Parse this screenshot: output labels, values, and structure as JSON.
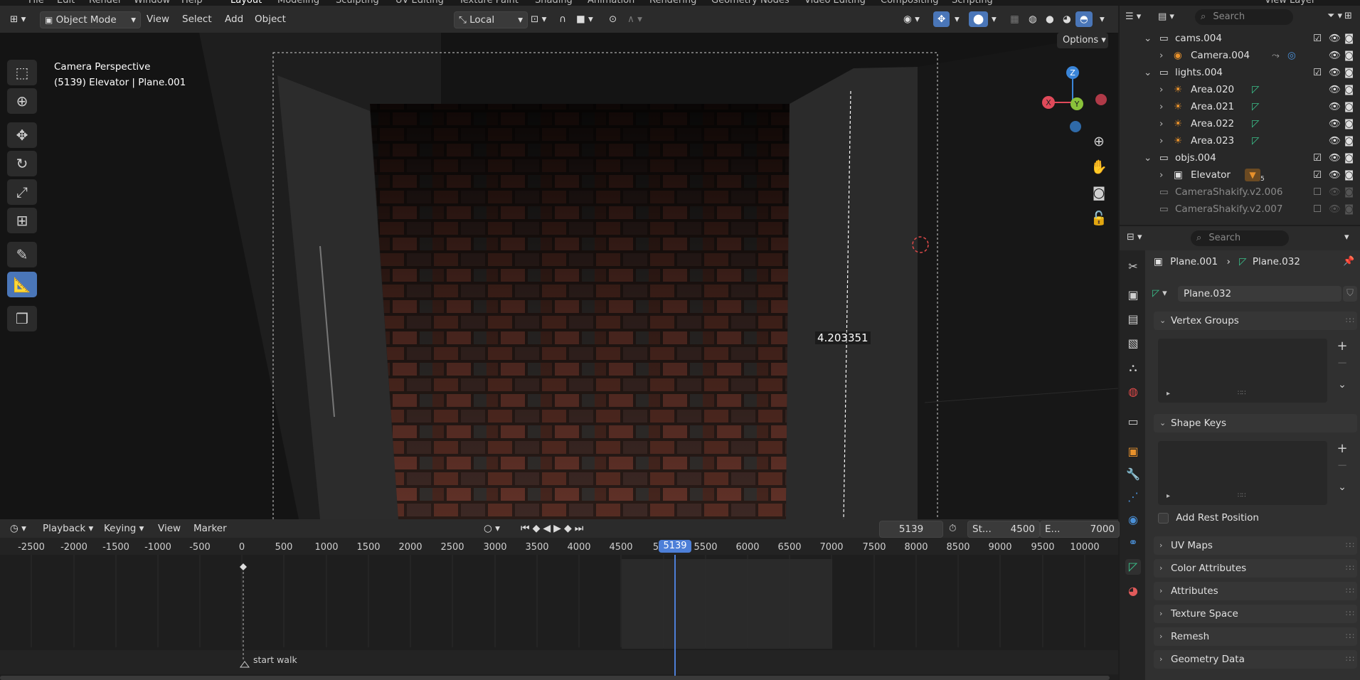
{
  "top_strip": {
    "items": [
      "File",
      "Edit",
      "Render",
      "Window",
      "Help",
      "Layout",
      "Modeling",
      "Sculpting",
      "UV Editing",
      "Texture Paint",
      "Shading",
      "Animation",
      "Rendering",
      "Geometry Nodes",
      "Video Editing",
      "Compositing",
      "Scripting",
      "View Layer"
    ]
  },
  "viewport_header": {
    "mode": "Object Mode",
    "menus": [
      "View",
      "Select",
      "Add",
      "Object"
    ],
    "orientation": "Local",
    "options_label": "Options"
  },
  "viewport": {
    "overlay_line1": "Camera Perspective",
    "overlay_line2": "(5139) Elevator | Plane.001",
    "measure_value": "4.203351",
    "gizmo": {
      "z": "Z",
      "y": "Y",
      "x": "X"
    },
    "tools": [
      "select-box-icon",
      "cursor-icon",
      "move-icon",
      "rotate-icon",
      "scale-icon",
      "transform-icon",
      "annotate-icon",
      "measure-icon",
      "add-cube-icon"
    ],
    "active_tool": "measure-icon"
  },
  "timeline": {
    "menus": [
      "Playback",
      "Keying",
      "View",
      "Marker"
    ],
    "current_frame": "5139",
    "start_label": "St...",
    "start_value": "4500",
    "end_label": "E...",
    "end_value": "7000",
    "ruler_ticks": [
      "-2500",
      "-2000",
      "-1500",
      "-1000",
      "-500",
      "0",
      "500",
      "1000",
      "1500",
      "2000",
      "2500",
      "3000",
      "3500",
      "4000",
      "4500",
      "5",
      "5500",
      "6000",
      "6500",
      "7000",
      "7500",
      "8000",
      "8500",
      "9000",
      "9500",
      "10000"
    ],
    "marker_label": "start walk",
    "playhead_label": "5139"
  },
  "outliner": {
    "search_placeholder": "Search",
    "rows": [
      {
        "label": "cams.004",
        "type": "collection",
        "level": 0,
        "expanded": true,
        "enabled": true
      },
      {
        "label": "Camera.004",
        "type": "camera",
        "level": 1,
        "expanded": false,
        "enabled": true
      },
      {
        "label": "lights.004",
        "type": "collection",
        "level": 0,
        "expanded": true,
        "enabled": true
      },
      {
        "label": "Area.020",
        "type": "light",
        "level": 1,
        "expanded": false,
        "enabled": true
      },
      {
        "label": "Area.021",
        "type": "light",
        "level": 1,
        "expanded": false,
        "enabled": true
      },
      {
        "label": "Area.022",
        "type": "light",
        "level": 1,
        "expanded": false,
        "enabled": true
      },
      {
        "label": "Area.023",
        "type": "light",
        "level": 1,
        "expanded": false,
        "enabled": true
      },
      {
        "label": "objs.004",
        "type": "collection",
        "level": 0,
        "expanded": true,
        "enabled": true
      },
      {
        "label": "Elevator",
        "type": "object",
        "level": 1,
        "expanded": false,
        "enabled": true,
        "badge": "5"
      },
      {
        "label": "CameraShakify.v2.006",
        "type": "collection",
        "level": 0,
        "expanded": false,
        "enabled": false
      },
      {
        "label": "CameraShakify.v2.007",
        "type": "collection",
        "level": 0,
        "expanded": false,
        "enabled": false
      }
    ]
  },
  "properties": {
    "search_placeholder": "Search",
    "breadcrumb_object": "Plane.001",
    "breadcrumb_data": "Plane.032",
    "mesh_name": "Plane.032",
    "panels": {
      "vertex_groups": "Vertex Groups",
      "shape_keys": "Shape Keys",
      "add_rest_position": "Add Rest Position",
      "collapsed": [
        "UV Maps",
        "Color Attributes",
        "Attributes",
        "Texture Space",
        "Remesh",
        "Geometry Data"
      ]
    },
    "tabs": [
      "tool-icon",
      "render-icon",
      "output-icon",
      "view-layer-icon",
      "scene-icon",
      "world-icon",
      "collection-icon",
      "object-icon",
      "modifier-icon",
      "particles-icon",
      "physics-icon",
      "constraints-icon",
      "data-icon",
      "material-icon"
    ]
  },
  "colors": {
    "accent": "#4a76b8",
    "playhead": "#4d7fd8",
    "gizmo_x": "#e04a5a",
    "gizmo_y": "#8ac23a",
    "gizmo_z": "#3a85d8",
    "orange": "#e8912b"
  }
}
